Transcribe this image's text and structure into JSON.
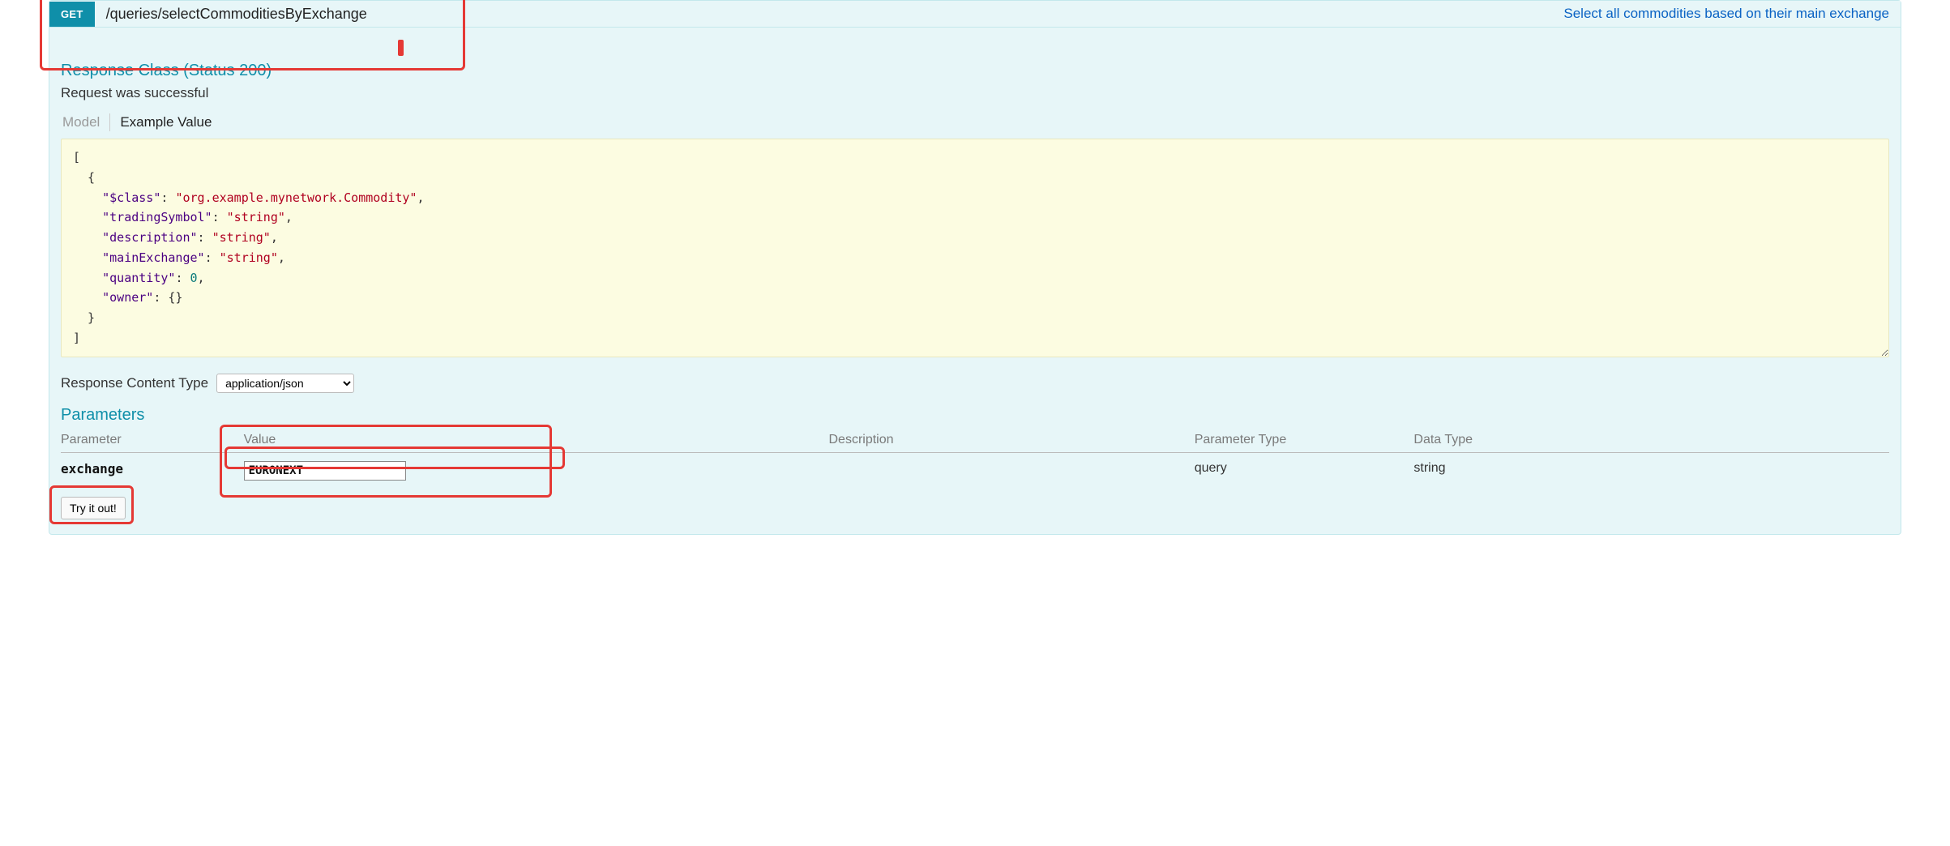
{
  "header": {
    "method": "GET",
    "path": "/queries/selectCommoditiesByExchange",
    "summary": "Select all commodities based on their main exchange"
  },
  "response": {
    "class_title": "Response Class (Status 200)",
    "status_text": "Request was successful",
    "tabs": {
      "model": "Model",
      "example": "Example Value"
    },
    "example_json": "[\n  {\n    \"$class\": \"org.example.mynetwork.Commodity\",\n    \"tradingSymbol\": \"string\",\n    \"description\": \"string\",\n    \"mainExchange\": \"string\",\n    \"quantity\": 0,\n    \"owner\": {}\n  }\n]",
    "content_type_label": "Response Content Type",
    "content_type_value": "application/json"
  },
  "parameters": {
    "title": "Parameters",
    "columns": {
      "name": "Parameter",
      "value": "Value",
      "description": "Description",
      "param_type": "Parameter Type",
      "data_type": "Data Type"
    },
    "rows": [
      {
        "name": "exchange",
        "value": "EURONEXT",
        "description": "",
        "param_type": "query",
        "data_type": "string"
      }
    ]
  },
  "actions": {
    "try": "Try it out!"
  }
}
